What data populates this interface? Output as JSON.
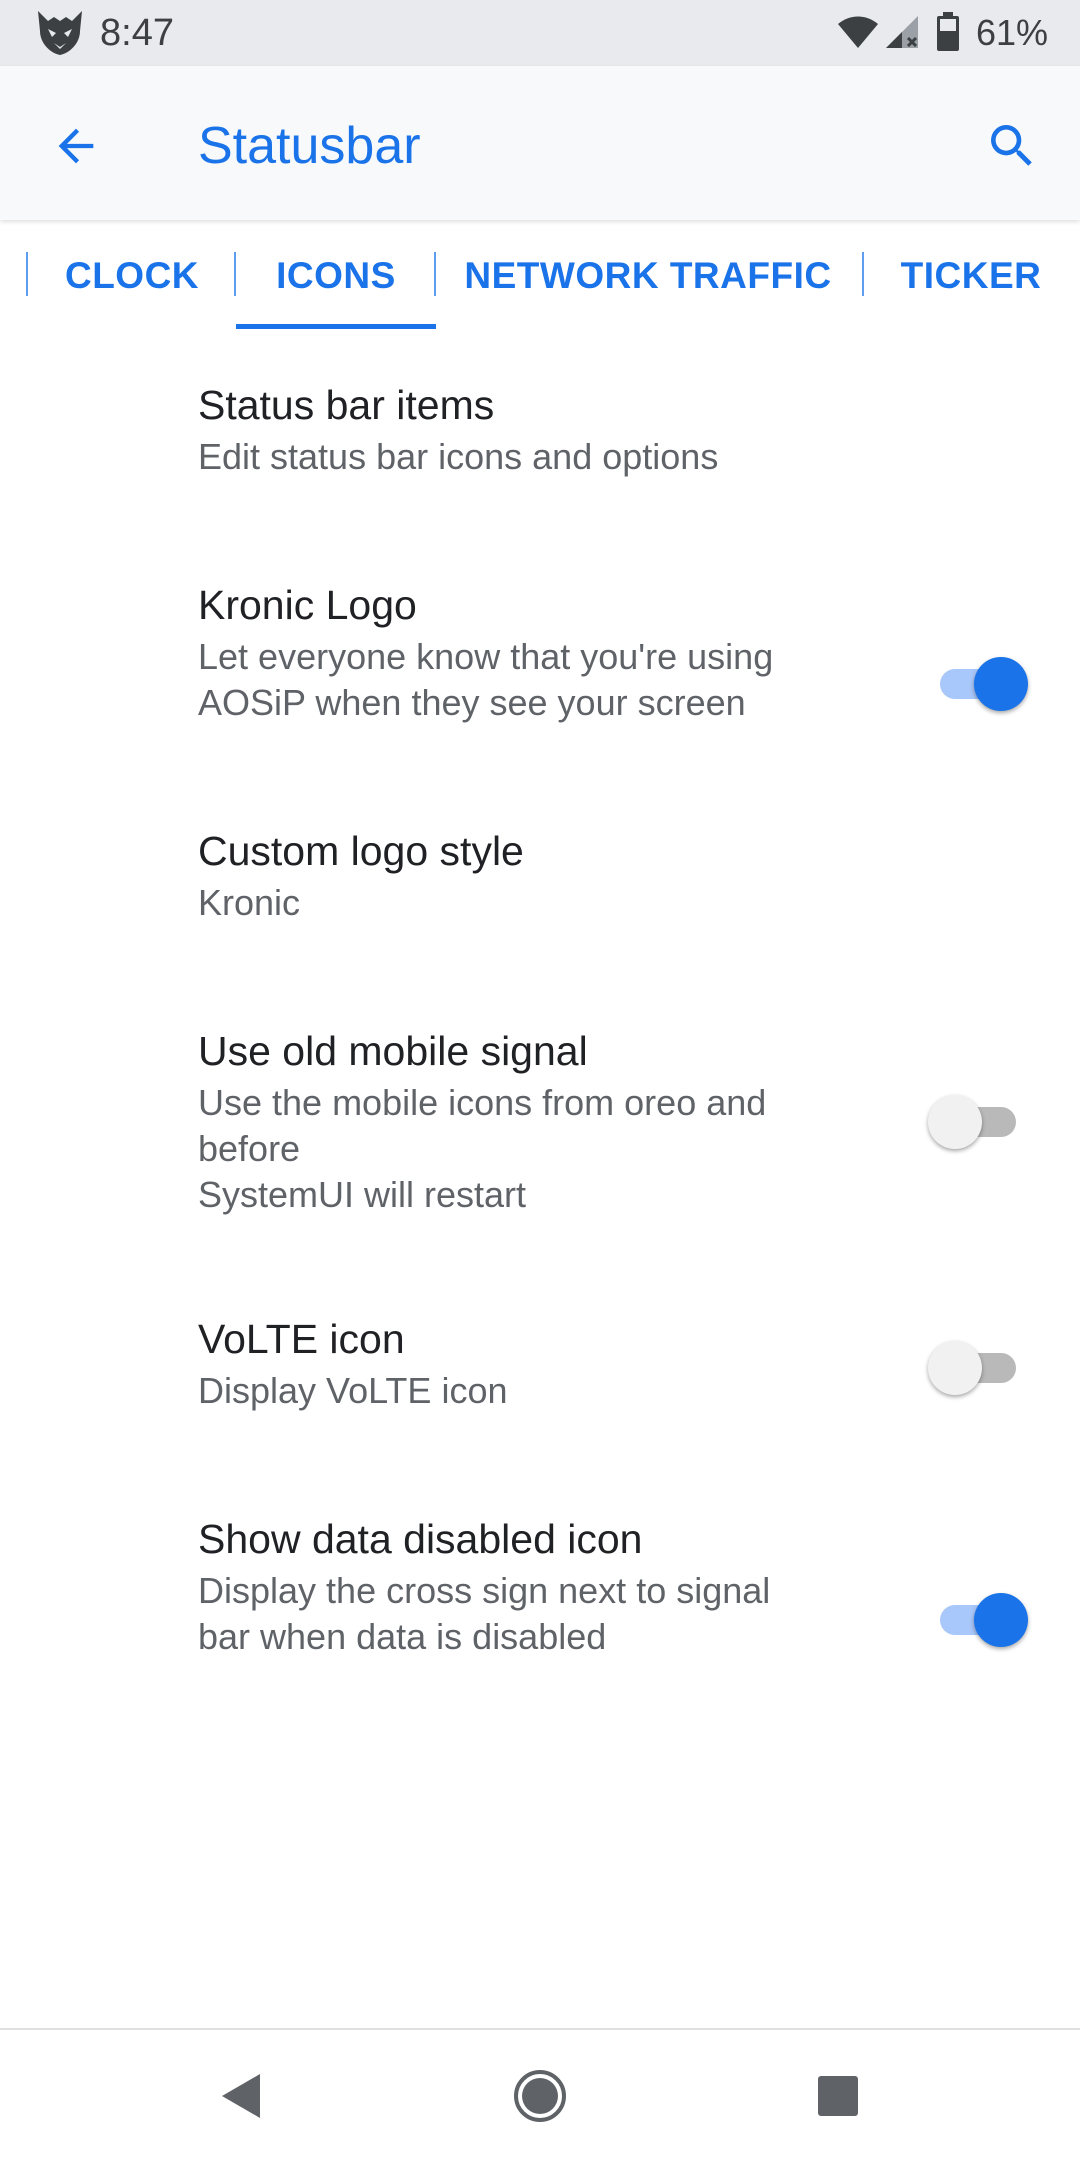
{
  "status_bar": {
    "time": "8:47",
    "battery_percent": "61%",
    "icons": [
      "app-logo-icon",
      "wifi-icon",
      "cell-signal-icon",
      "battery-icon"
    ]
  },
  "app_bar": {
    "title": "Statusbar",
    "back_icon": "arrow-back-icon",
    "search_icon": "search-icon"
  },
  "tabs": [
    {
      "label": "CLOCK",
      "selected": false
    },
    {
      "label": "ICONS",
      "selected": true
    },
    {
      "label": "NETWORK TRAFFIC",
      "selected": false
    },
    {
      "label": "TICKER",
      "selected": false
    }
  ],
  "preferences": [
    {
      "title": "Status bar items",
      "summary": "Edit status bar icons and options"
    },
    {
      "title": "Kronic Logo",
      "summary": "Let everyone know that you're using\nAOSiP when they see your screen",
      "switch_on": true
    },
    {
      "title": "Custom logo style",
      "summary": "Kronic"
    },
    {
      "title": "Use old mobile signal",
      "summary": "Use the mobile icons from oreo and\nbefore\nSystemUI will restart",
      "switch_on": false
    },
    {
      "title": "VoLTE icon",
      "summary": "Display VoLTE icon",
      "switch_on": false
    },
    {
      "title": "Show data disabled icon",
      "summary": "Display the cross sign next to signal\nbar when data is disabled",
      "switch_on": true
    }
  ],
  "nav_bar": {
    "icons": [
      "nav-back-icon",
      "nav-home-icon",
      "nav-recents-icon"
    ]
  },
  "colors": {
    "accent": "#1a73e8",
    "status_bar_bg": "#e8eaed",
    "app_bar_bg": "#f8f9fa"
  }
}
